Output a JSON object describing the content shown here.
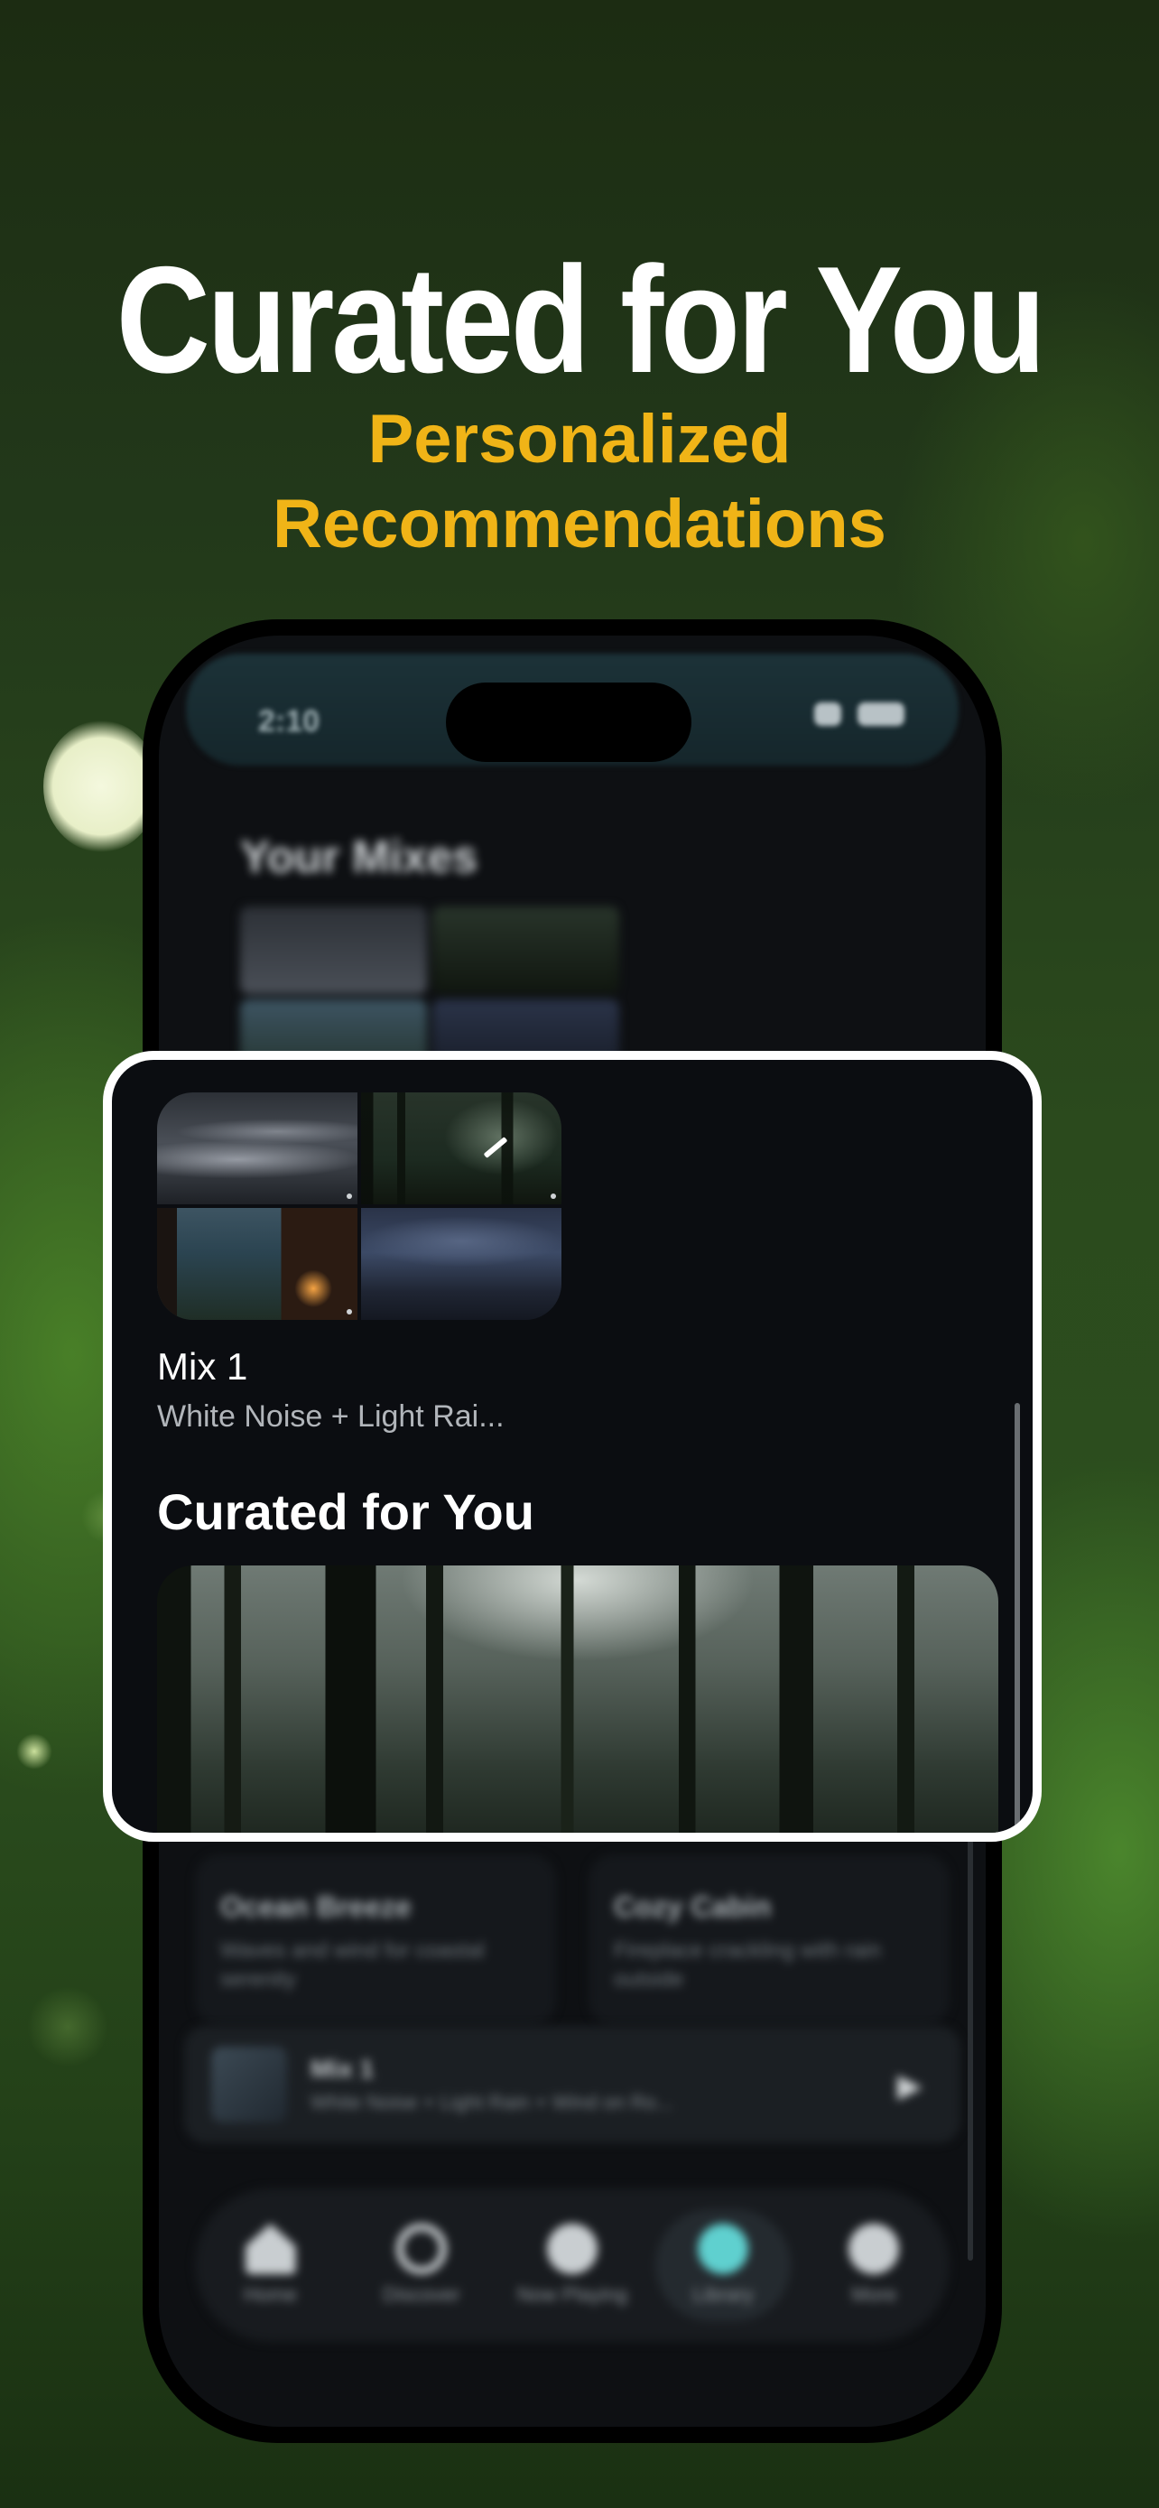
{
  "promo": {
    "headline": "Curated for You",
    "subline_1": "Personalized",
    "subline_2": "Recommendations"
  },
  "colors": {
    "headline": "#ffffff",
    "subline": "#f0b417",
    "accent": "#5fd0cf"
  },
  "status_bar": {
    "time": "2:10"
  },
  "background_screen": {
    "section_title": "Your Mixes",
    "cards": [
      {
        "title": "Ocean Breeze",
        "subtitle": "Waves and wind for coastal serenity"
      },
      {
        "title": "Cozy Cabin",
        "subtitle": "Fireplace crackling with rain outside"
      }
    ],
    "now_playing": {
      "title": "Mix 1",
      "subtitle": "White Noise + Light Rain + Wind on Ro..."
    },
    "tabs": [
      {
        "label": "Home",
        "icon": "home-icon"
      },
      {
        "label": "Discover",
        "icon": "search-icon"
      },
      {
        "label": "Now Playing",
        "icon": "now-playing-icon"
      },
      {
        "label": "Library",
        "icon": "library-icon",
        "active": true
      },
      {
        "label": "More",
        "icon": "more-icon"
      }
    ]
  },
  "highlight": {
    "mix": {
      "title": "Mix 1",
      "subtitle": "White Noise + Light Rai..."
    },
    "section_title": "Curated for You",
    "edit_icon": "pencil-icon"
  }
}
